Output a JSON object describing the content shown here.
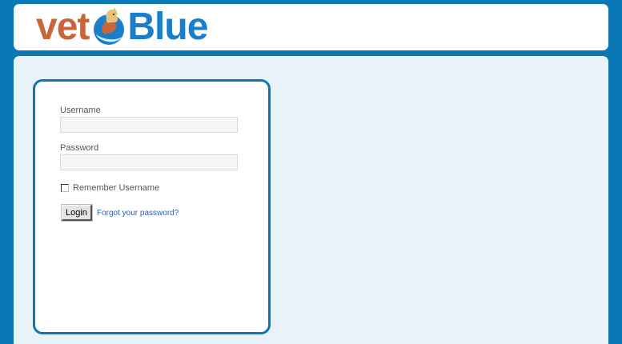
{
  "header": {
    "logo_text_left": "vet",
    "logo_text_right": "Blue"
  },
  "login": {
    "username_label": "Username",
    "username_value": "",
    "password_label": "Password",
    "password_value": "",
    "remember_label": "Remember Username",
    "remember_checked": false,
    "login_button_label": "Login",
    "forgot_link_label": "Forgot your password?"
  },
  "colors": {
    "page_background": "#0a78b4",
    "content_background": "#e9f1f9",
    "logo_vet": "#c8663a",
    "logo_blue": "#1a7fc8",
    "link": "#2b5fa8"
  },
  "icons": {
    "logo_mark": "horse-globe-logo-icon",
    "checkbox": "checkbox-icon"
  }
}
